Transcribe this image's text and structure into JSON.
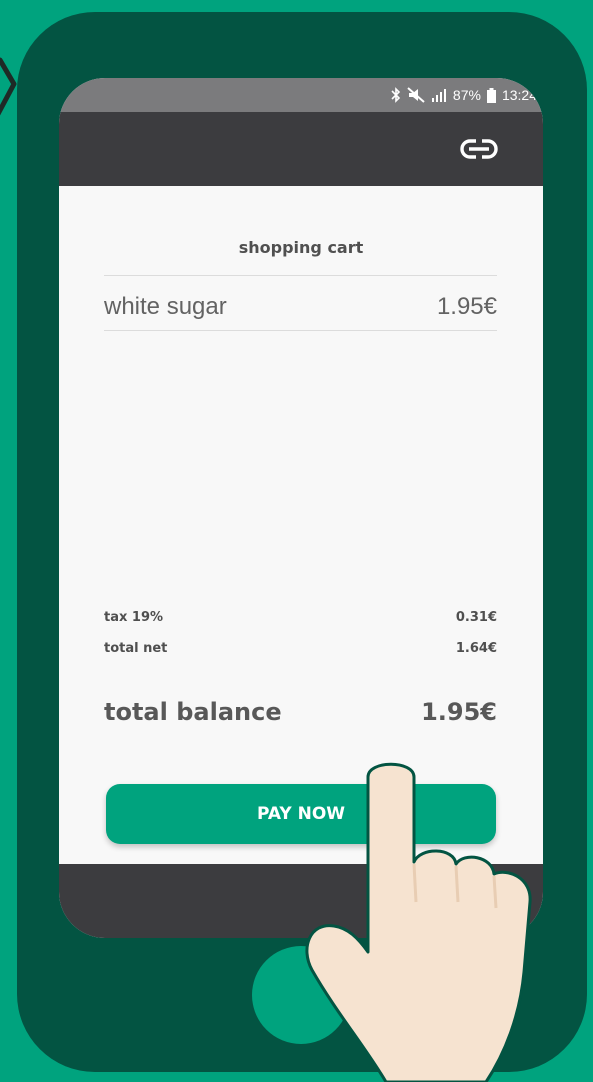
{
  "status_bar": {
    "battery": "87%",
    "time": "13:24",
    "icons": [
      "bluetooth-icon",
      "mute-icon",
      "signal-icon",
      "battery-icon"
    ]
  },
  "app_bar": {
    "icon": "link-icon"
  },
  "cart": {
    "title": "shopping cart",
    "items": [
      {
        "name": "white sugar",
        "price": "1.95€"
      }
    ]
  },
  "summary": {
    "tax_label": "tax 19%",
    "tax_value": "0.31€",
    "net_label": "total net",
    "net_value": "1.64€",
    "total_label": "total balance",
    "total_value": "1.95€"
  },
  "pay_button": {
    "label": "PAY NOW"
  },
  "colors": {
    "background": "#00a37e",
    "phone": "#035442",
    "bar": "#3c3c3f",
    "accent": "#00a37e"
  }
}
